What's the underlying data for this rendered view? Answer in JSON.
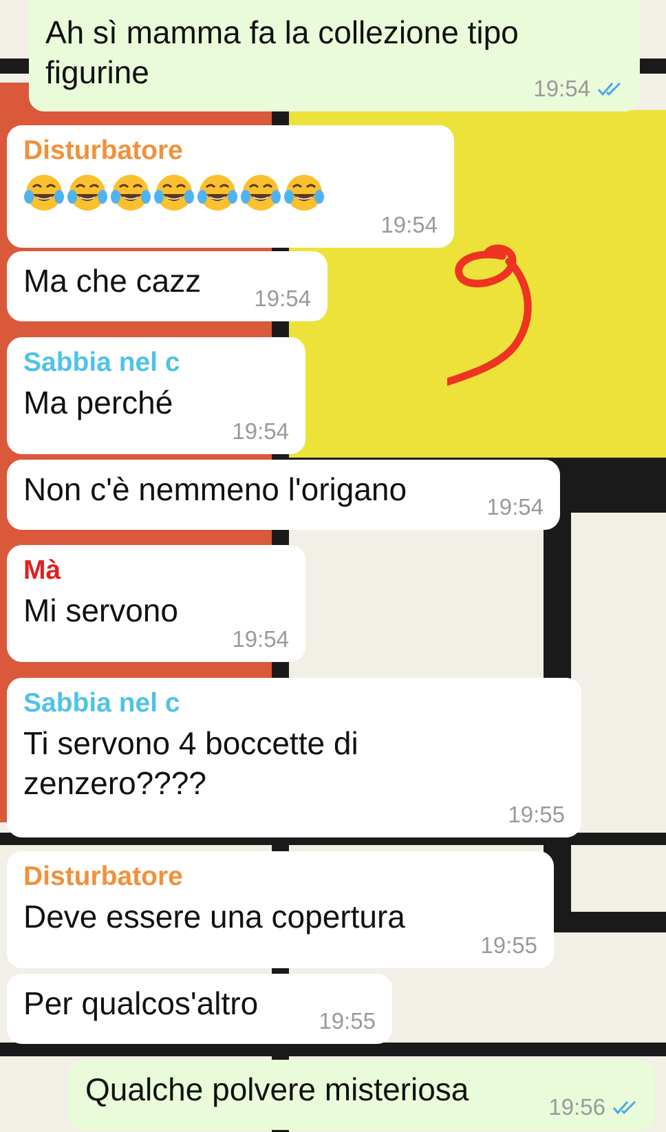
{
  "colors": {
    "sender_disturbatore": "#f0913a",
    "sender_sabbia": "#4fc3e6",
    "sender_ma": "#e02020",
    "outgoing_bubble": "#e9fbd9",
    "incoming_bubble": "#ffffff",
    "read_check": "#4aa8e8",
    "annotation": "#ee3322"
  },
  "messages": [
    {
      "sender": "",
      "text": "Ah sì mamma fa la collezione tipo figurine",
      "time": "19:54",
      "direction": "out",
      "status_icon": "double-check-icon"
    },
    {
      "sender": "Disturbatore",
      "text": "😂😂😂😂😂😂😂",
      "time": "19:54",
      "direction": "in",
      "emoji_count": 7,
      "emoji_icon": "tears-of-joy-emoji-icon"
    },
    {
      "sender": "",
      "text": "Ma che cazz",
      "time": "19:54",
      "direction": "in"
    },
    {
      "sender": "Sabbia nel c",
      "text": "Ma perché",
      "time": "19:54",
      "direction": "in"
    },
    {
      "sender": "",
      "text": "Non c'è nemmeno l'origano",
      "time": "19:54",
      "direction": "in"
    },
    {
      "sender": "Mà",
      "text": "Mi servono",
      "time": "19:54",
      "direction": "in"
    },
    {
      "sender": "Sabbia nel c",
      "text": "Ti servono 4 boccette di zenzero????",
      "time": "19:55",
      "direction": "in"
    },
    {
      "sender": "Disturbatore",
      "text": "Deve essere una copertura",
      "time": "19:55",
      "direction": "in"
    },
    {
      "sender": "",
      "text": "Per qualcos'altro",
      "time": "19:55",
      "direction": "in"
    },
    {
      "sender": "",
      "text": "Qualche polvere misteriosa",
      "time": "19:56",
      "direction": "out",
      "status_icon": "double-check-icon"
    }
  ],
  "annotation": {
    "glyph": "9-shaped-scribble-icon"
  }
}
